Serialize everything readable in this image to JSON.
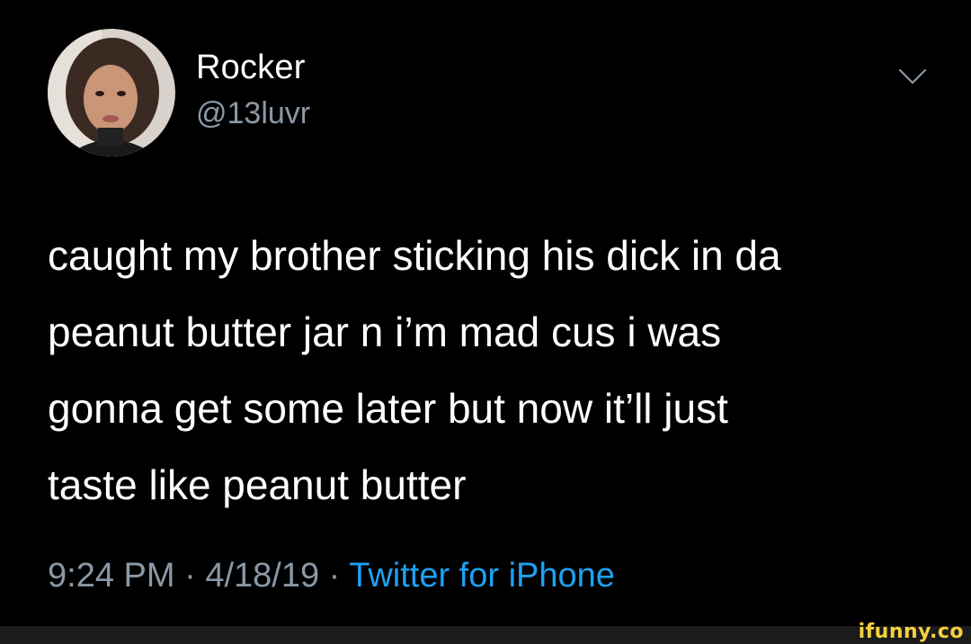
{
  "user": {
    "display_name": "Rocker",
    "handle": "@13luvr",
    "avatar_icon": "profile-photo"
  },
  "menu": {
    "icon": "chevron-down-icon"
  },
  "tweet": {
    "lines": [
      "caught my brother sticking his dick in da",
      "peanut butter jar n i’m mad cus i was",
      "gonna get some later but now it’ll just",
      "taste like peanut butter"
    ]
  },
  "meta": {
    "time": "9:24 PM",
    "sep1": " · ",
    "date": "4/18/19",
    "sep2": " · ",
    "source": "Twitter for iPhone"
  },
  "colors": {
    "background": "#000000",
    "secondary_text": "#8b98a5",
    "link": "#1da1f2",
    "watermark": "#f5d13d"
  },
  "watermark": "ifunny.co"
}
